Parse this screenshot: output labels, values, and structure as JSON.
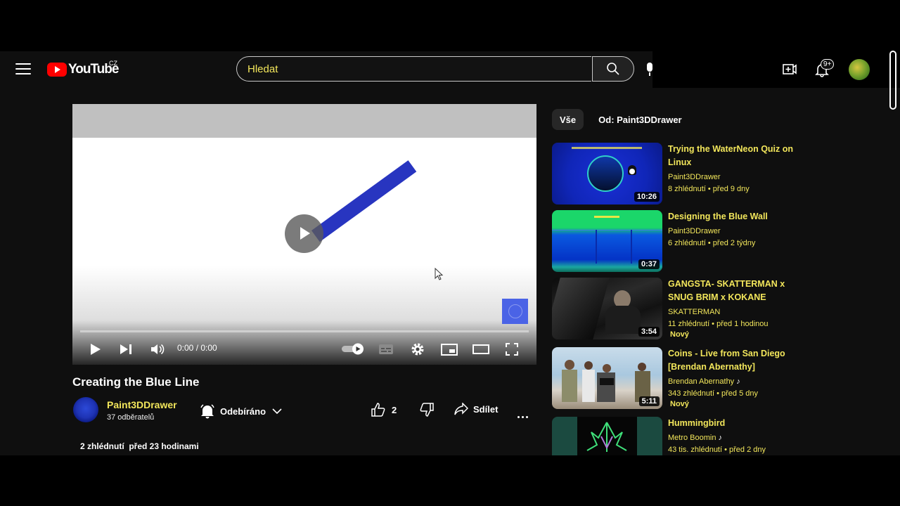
{
  "header": {
    "logo_text": "YouTube",
    "region": "CZ",
    "search_placeholder": "Hledat",
    "notifications_badge": "9+"
  },
  "player": {
    "time": "0:00 / 0:00",
    "progress": 0
  },
  "video": {
    "title": "Creating the Blue Line",
    "channel": "Paint3DDrawer",
    "subscribers": "37 odběratelů",
    "subscribe_label": "Odebíráno",
    "likes": "2",
    "share_label": "Sdílet",
    "views_line": "2 zhlédnutí  před 23 hodinami"
  },
  "sidebar": {
    "chips": [
      {
        "label": "Vše",
        "active": true
      },
      {
        "label": "Od: Paint3DDrawer",
        "active": false
      }
    ],
    "items": [
      {
        "title": "Trying the WaterNeon Quiz on Linux",
        "channel": "Paint3DDrawer",
        "views": "8 zhlédnutí",
        "age": "před 9 dny",
        "duration": "10:26",
        "new": ""
      },
      {
        "title": "Designing the Blue Wall",
        "channel": "Paint3DDrawer",
        "views": "6 zhlédnutí",
        "age": "před 2 týdny",
        "duration": "0:37",
        "new": ""
      },
      {
        "title": "GANGSTA- SKATTERMAN x SNUG BRIM x KOKANE",
        "channel": "SKATTERMAN",
        "views": "11 zhlédnutí",
        "age": "před 1 hodinou",
        "duration": "3:54",
        "new": "Nový"
      },
      {
        "title": "Coins - Live from San Diego [Brendan Abernathy]",
        "channel": "Brendan Abernathy",
        "views": "343 zhlédnutí",
        "age": "před 5 dny",
        "duration": "5:11",
        "new": "Nový"
      },
      {
        "title": "Hummingbird",
        "channel": "Metro Boomin",
        "views": "43 tis. zhlédnutí",
        "age": "před 2 dny",
        "duration": "",
        "new": ""
      }
    ]
  }
}
